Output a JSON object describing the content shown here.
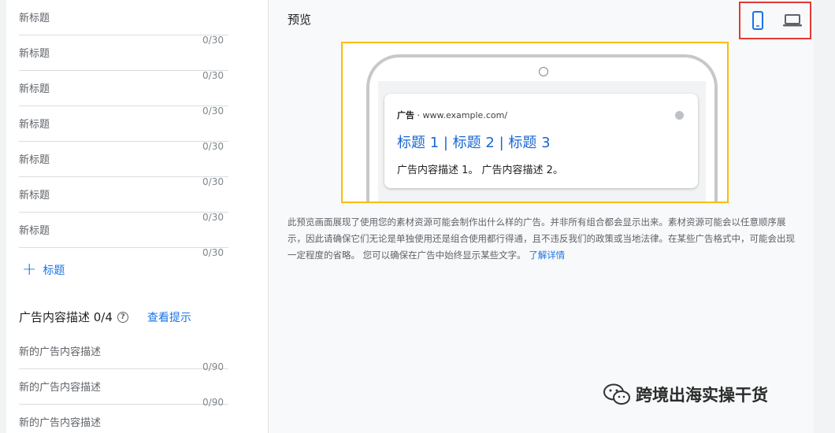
{
  "headlines": {
    "placeholder": "新标题",
    "counter": "0/30",
    "count": 7,
    "add_label": "标题"
  },
  "descriptions": {
    "title": "广告内容描述 0/4",
    "tips_link": "查看提示",
    "placeholder": "新的广告内容描述",
    "counter": "0/90"
  },
  "preview": {
    "title": "预览",
    "devices": [
      "mobile-icon",
      "laptop-icon"
    ],
    "selected_device": "mobile",
    "ad": {
      "label": "广告",
      "separator": "·",
      "url": "www.example.com/",
      "headline": "标题 1 | 标题 2 | 标题 3",
      "description": "广告内容描述 1。 广告内容描述 2。"
    },
    "note": "此预览画面展现了使用您的素材资源可能会制作出什么样的广告。并非所有组合都会显示出来。素材资源可能会以任意顺序展示，因此请确保它们无论是单独使用还是组合使用都行得通，且不违反我们的政策或当地法律。在某些广告格式中，可能会出现一定程度的省略。 您可以确保在广告中始终显示某些文字。",
    "learn_more": "了解详情"
  },
  "watermark": "跨境出海实操干货",
  "colors": {
    "accent": "#1a73e8",
    "highlight_yellow": "#fbbc04",
    "highlight_red": "#e53935"
  }
}
